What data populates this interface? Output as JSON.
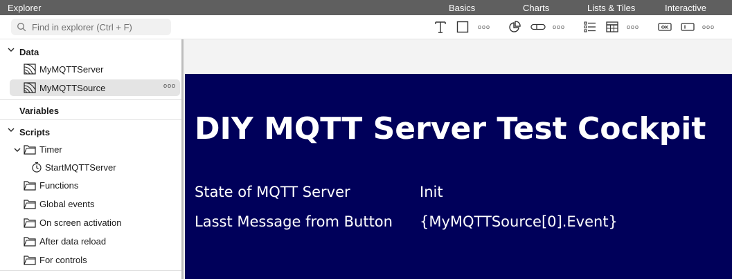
{
  "app": {
    "title": "Explorer"
  },
  "categories": [
    {
      "label": "Basics"
    },
    {
      "label": "Charts"
    },
    {
      "label": "Lists & Tiles"
    },
    {
      "label": "Interactive"
    }
  ],
  "search": {
    "placeholder": "Find in explorer (Ctrl + F)",
    "value": ""
  },
  "toolbar": {
    "tools": [
      {
        "icon": "text-icon"
      },
      {
        "icon": "rectangle-icon"
      },
      {
        "icon": "more-basics-icon"
      },
      {
        "icon": "pie-chart-icon"
      },
      {
        "icon": "bar-icon"
      },
      {
        "icon": "more-charts-icon"
      },
      {
        "icon": "list-icon"
      },
      {
        "icon": "table-icon"
      },
      {
        "icon": "more-lists-icon"
      },
      {
        "icon": "ok-button-icon"
      },
      {
        "icon": "text-input-icon"
      },
      {
        "icon": "more-interactive-icon"
      }
    ],
    "ok_label": "OK"
  },
  "sidebar": {
    "data": {
      "label": "Data",
      "items": [
        {
          "label": "MyMQTTServer",
          "icon": "data-source-icon"
        },
        {
          "label": "MyMQTTSource",
          "icon": "data-source-icon",
          "selected": true
        }
      ]
    },
    "variables": {
      "label": "Variables"
    },
    "scripts": {
      "label": "Scripts",
      "timer": {
        "label": "Timer",
        "icon": "folder-icon"
      },
      "timer_child": {
        "label": "StartMQTTServer",
        "icon": "stopwatch-icon"
      },
      "folders": [
        {
          "label": "Functions",
          "icon": "folder-icon"
        },
        {
          "label": "Global events",
          "icon": "folder-icon"
        },
        {
          "label": "On screen activation",
          "icon": "folder-icon"
        },
        {
          "label": "After data reload",
          "icon": "folder-icon"
        },
        {
          "label": "For controls",
          "icon": "folder-icon"
        }
      ]
    }
  },
  "screen": {
    "background": "#00005a",
    "title": "DIY MQTT Server Test Cockpit",
    "rows": [
      {
        "label": "State of MQTT Server",
        "value": "Init"
      },
      {
        "label": "Lasst Message from Button",
        "value": "{MyMQTTSource[0].Event}"
      }
    ]
  }
}
